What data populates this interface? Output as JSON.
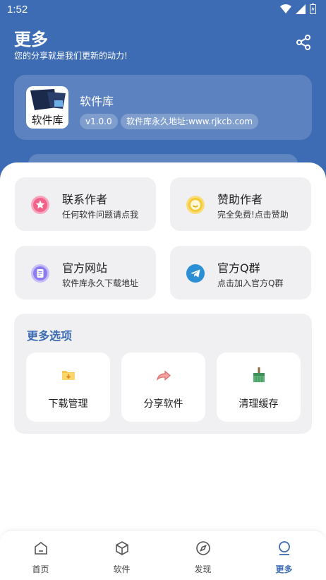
{
  "status": {
    "time": "1:52"
  },
  "header": {
    "title": "更多",
    "subtitle": "您的分享就是我们更新的动力!"
  },
  "app": {
    "name": "软件库",
    "version": "v1.0.0",
    "url_label": "软件库永久地址:www.rjkcb.com",
    "logo_text": "软件库"
  },
  "actions": [
    {
      "title": "联系作者",
      "subtitle": "任何软件问题请点我",
      "icon": "star-icon",
      "color": "#f0628a"
    },
    {
      "title": "赞助作者",
      "subtitle": "完全免费!点击赞助",
      "icon": "smile-icon",
      "color": "#f5c935"
    },
    {
      "title": "官方网站",
      "subtitle": "软件库永久下载地址",
      "icon": "document-icon",
      "color": "#8d7cf0"
    },
    {
      "title": "官方Q群",
      "subtitle": "点击加入官方Q群",
      "icon": "telegram-icon",
      "color": "#2b8fd6"
    }
  ],
  "more": {
    "title": "更多选项",
    "tiles": [
      {
        "label": "下载管理",
        "icon": "folder-download-icon"
      },
      {
        "label": "分享软件",
        "icon": "share-arrow-icon"
      },
      {
        "label": "清理缓存",
        "icon": "broom-icon"
      }
    ]
  },
  "nav": [
    {
      "label": "首页",
      "icon": "home-icon",
      "active": false
    },
    {
      "label": "软件",
      "icon": "cube-icon",
      "active": false
    },
    {
      "label": "发现",
      "icon": "compass-icon",
      "active": false
    },
    {
      "label": "更多",
      "icon": "profile-icon",
      "active": true
    }
  ],
  "colors": {
    "primary": "#3d6cb4",
    "card": "#f0f0f2"
  }
}
